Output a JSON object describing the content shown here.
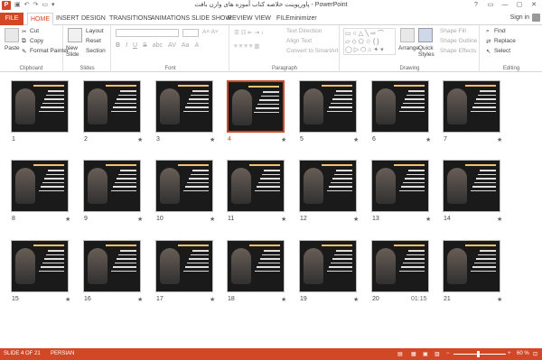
{
  "window": {
    "title": "پاورپوینت خلاصه کتاب آموزه های وارن بافت - PowerPoint",
    "controls": [
      "?",
      "▭",
      "—",
      "▢",
      "✕"
    ]
  },
  "tabs": {
    "file": "FILE",
    "items": [
      "HOME",
      "INSERT",
      "DESIGN",
      "TRANSITIONS",
      "ANIMATIONS",
      "SLIDE SHOW",
      "REVIEW",
      "VIEW",
      "FILEminimizer"
    ],
    "active": "HOME",
    "sign_in": "Sign in"
  },
  "ribbon": {
    "clipboard": {
      "paste": "Paste",
      "cut": "Cut",
      "copy": "Copy",
      "format_painter": "Format Painter",
      "label": "Clipboard"
    },
    "slides": {
      "new_slide": "New Slide",
      "layout": "Layout",
      "reset": "Reset",
      "section": "Section",
      "label": "Slides"
    },
    "font": {
      "label": "Font",
      "bold": "B",
      "italic": "I",
      "underline": "U",
      "strike": "S",
      "shadow": "abc",
      "spacing": "AV",
      "case": "Aa",
      "color": "A"
    },
    "paragraph": {
      "text_direction": "Text Direction",
      "align_text": "Align Text",
      "convert_smartart": "Convert to SmartArt",
      "label": "Paragraph"
    },
    "drawing": {
      "arrange": "Arrange",
      "quick_styles": "Quick Styles",
      "shape_fill": "Shape Fill",
      "shape_outline": "Shape Outline",
      "shape_effects": "Shape Effects",
      "label": "Drawing"
    },
    "editing": {
      "find": "Find",
      "replace": "Replace",
      "select": "Select",
      "label": "Editing"
    }
  },
  "slides": [
    {
      "n": "1",
      "star": ""
    },
    {
      "n": "2",
      "star": "★"
    },
    {
      "n": "3",
      "star": "★"
    },
    {
      "n": "4",
      "star": "★"
    },
    {
      "n": "5",
      "star": "★"
    },
    {
      "n": "6",
      "star": "★"
    },
    {
      "n": "7",
      "star": "★"
    },
    {
      "n": "8",
      "star": "★"
    },
    {
      "n": "9",
      "star": "★"
    },
    {
      "n": "10",
      "star": "★"
    },
    {
      "n": "11",
      "star": "★"
    },
    {
      "n": "12",
      "star": "★"
    },
    {
      "n": "13",
      "star": "★"
    },
    {
      "n": "14",
      "star": "★"
    },
    {
      "n": "15",
      "star": "★"
    },
    {
      "n": "16",
      "star": "★"
    },
    {
      "n": "17",
      "star": "★"
    },
    {
      "n": "18",
      "star": "★"
    },
    {
      "n": "19",
      "star": "★"
    },
    {
      "n": "20",
      "star": "01:15"
    },
    {
      "n": "21",
      "star": "★"
    }
  ],
  "selected_slide": "4",
  "status": {
    "slide_info": "SLIDE 4 OF 21",
    "language": "PERSIAN",
    "zoom": "60 %",
    "zoom_level": 0.6
  }
}
